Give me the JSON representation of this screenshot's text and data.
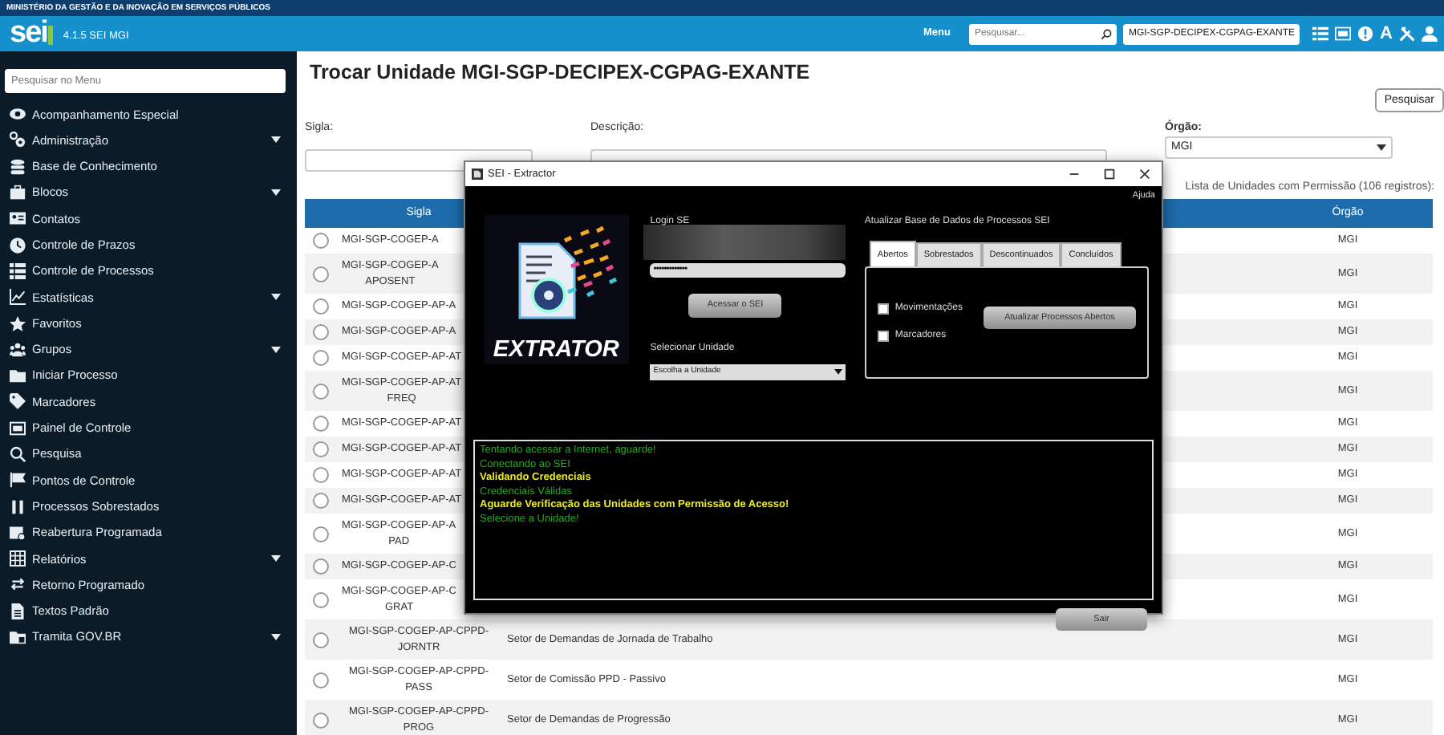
{
  "gov_bar": {
    "text": "MINISTÉRIO DA GESTÃO E DA INOVAÇÃO EM SERVIÇOS PÚBLICOS"
  },
  "header": {
    "logo": "sei",
    "version": "4.1.5 SEI MGI",
    "menu": "Menu",
    "search_placeholder": "Pesquisar...",
    "unit": "MGI-SGP-DECIPEX-CGPAG-EXANTE",
    "font_icon": "A"
  },
  "sidebar": {
    "search_placeholder": "Pesquisar no Menu",
    "items": [
      {
        "label": "Acompanhamento Especial",
        "submenu": false
      },
      {
        "label": "Administração",
        "submenu": true
      },
      {
        "label": "Base de Conhecimento",
        "submenu": false
      },
      {
        "label": "Blocos",
        "submenu": true
      },
      {
        "label": "Contatos",
        "submenu": false
      },
      {
        "label": "Controle de Prazos",
        "submenu": false
      },
      {
        "label": "Controle de Processos",
        "submenu": false
      },
      {
        "label": "Estatísticas",
        "submenu": true
      },
      {
        "label": "Favoritos",
        "submenu": false
      },
      {
        "label": "Grupos",
        "submenu": true
      },
      {
        "label": "Iniciar Processo",
        "submenu": false
      },
      {
        "label": "Marcadores",
        "submenu": false
      },
      {
        "label": "Painel de Controle",
        "submenu": false
      },
      {
        "label": "Pesquisa",
        "submenu": false
      },
      {
        "label": "Pontos de Controle",
        "submenu": false
      },
      {
        "label": "Processos Sobrestados",
        "submenu": false
      },
      {
        "label": "Reabertura Programada",
        "submenu": false
      },
      {
        "label": "Relatórios",
        "submenu": true
      },
      {
        "label": "Retorno Programado",
        "submenu": false
      },
      {
        "label": "Textos Padrão",
        "submenu": false
      },
      {
        "label": "Tramita GOV.BR",
        "submenu": true
      }
    ]
  },
  "page": {
    "title": "Trocar Unidade MGI-SGP-DECIPEX-CGPAG-EXANTE",
    "search_button": "Pesquisar",
    "filters": [
      {
        "label": "Sigla:",
        "kind": "text"
      },
      {
        "label": "Descrição:",
        "kind": "text"
      },
      {
        "label": "Órgão:",
        "kind": "select",
        "value": "MGI"
      }
    ],
    "caption": "Lista de Unidades com Permissão (106 registros):"
  },
  "table": {
    "columns": {
      "sigla": "Sigla",
      "orgao": "Órgão"
    },
    "rows": [
      {
        "selected": false,
        "sigla": [
          "MGI-SGP-COGEP-A"
        ],
        "orgao": "MGI"
      },
      {
        "selected": false,
        "sigla": [
          "MGI-SGP-COGEP-A",
          "APOSENT"
        ],
        "orgao": "MGI"
      },
      {
        "selected": false,
        "sigla": [
          "MGI-SGP-COGEP-AP-A"
        ],
        "orgao": "MGI"
      },
      {
        "selected": false,
        "sigla": [
          "MGI-SGP-COGEP-AP-A"
        ],
        "orgao": "MGI"
      },
      {
        "selected": false,
        "sigla": [
          "MGI-SGP-COGEP-AP-AT"
        ],
        "orgao": "MGI"
      },
      {
        "selected": false,
        "sigla": [
          "MGI-SGP-COGEP-AP-AT",
          "FREQ"
        ],
        "orgao": "MGI"
      },
      {
        "selected": false,
        "sigla": [
          "MGI-SGP-COGEP-AP-AT"
        ],
        "orgao": "MGI"
      },
      {
        "selected": false,
        "sigla": [
          "MGI-SGP-COGEP-AP-AT"
        ],
        "orgao": "MGI"
      },
      {
        "selected": false,
        "sigla": [
          "MGI-SGP-COGEP-AP-AT"
        ],
        "orgao": "MGI"
      },
      {
        "selected": false,
        "sigla": [
          "MGI-SGP-COGEP-AP-AT"
        ],
        "orgao": "MGI"
      },
      {
        "selected": false,
        "sigla": [
          "MGI-SGP-COGEP-AP-A",
          "PAD"
        ],
        "orgao": "MGI"
      },
      {
        "selected": false,
        "sigla": [
          "MGI-SGP-COGEP-AP-C"
        ],
        "orgao": "MGI"
      },
      {
        "selected": false,
        "sigla": [
          "MGI-SGP-COGEP-AP-C",
          "GRAT"
        ],
        "orgao": "MGI"
      },
      {
        "selected": false,
        "sigla": [
          "MGI-SGP-COGEP-AP-CPPD-",
          "JORNTR"
        ],
        "descricao": "Setor de Demandas de Jornada de Trabalho",
        "orgao": "MGI"
      },
      {
        "selected": false,
        "sigla": [
          "MGI-SGP-COGEP-AP-CPPD-",
          "PASS"
        ],
        "descricao": "Setor de Comissão PPD - Passivo",
        "orgao": "MGI"
      },
      {
        "selected": false,
        "sigla": [
          "MGI-SGP-COGEP-AP-CPPD-",
          "PROG"
        ],
        "descricao": "Setor de Demandas de Progressão",
        "orgao": "MGI"
      }
    ]
  },
  "dialog": {
    "title": "SEI - Extractor",
    "help": "Ajuda",
    "logo_text": "EXTRATOR",
    "login_label": "Login SE",
    "password": "•••••••••••••",
    "login_button": "Acessar o SEI",
    "unit_label": "Selecionar Unidade",
    "unit_select": "Escolha a Unidade",
    "update_title": "Atualizar Base de Dados de Processos SEI",
    "tabs": [
      {
        "label": "Abertos",
        "selected": true
      },
      {
        "label": "Sobrestados",
        "selected": false
      },
      {
        "label": "Descontinuados",
        "selected": false
      },
      {
        "label": "Concluídos",
        "selected": false
      }
    ],
    "checkboxes": [
      {
        "label": "Movimentações",
        "checked": false
      },
      {
        "label": "Marcadores",
        "checked": false
      }
    ],
    "update_button": "Atualizar Processos Abertos",
    "log": [
      {
        "text": "Tentando acessar a Internet, aguarde!",
        "kind": "info"
      },
      {
        "text": "Conectando ao SEI",
        "kind": "info"
      },
      {
        "text": "Validando Credenciais",
        "kind": "warn"
      },
      {
        "text": "Credenciais Válidas",
        "kind": "info"
      },
      {
        "text": "Aguarde Verificação das Unidades com Permissão de Acesso!",
        "kind": "warn"
      },
      {
        "text": "Selecione a Unidade!",
        "kind": "info"
      }
    ],
    "exit_button": "Sair"
  }
}
